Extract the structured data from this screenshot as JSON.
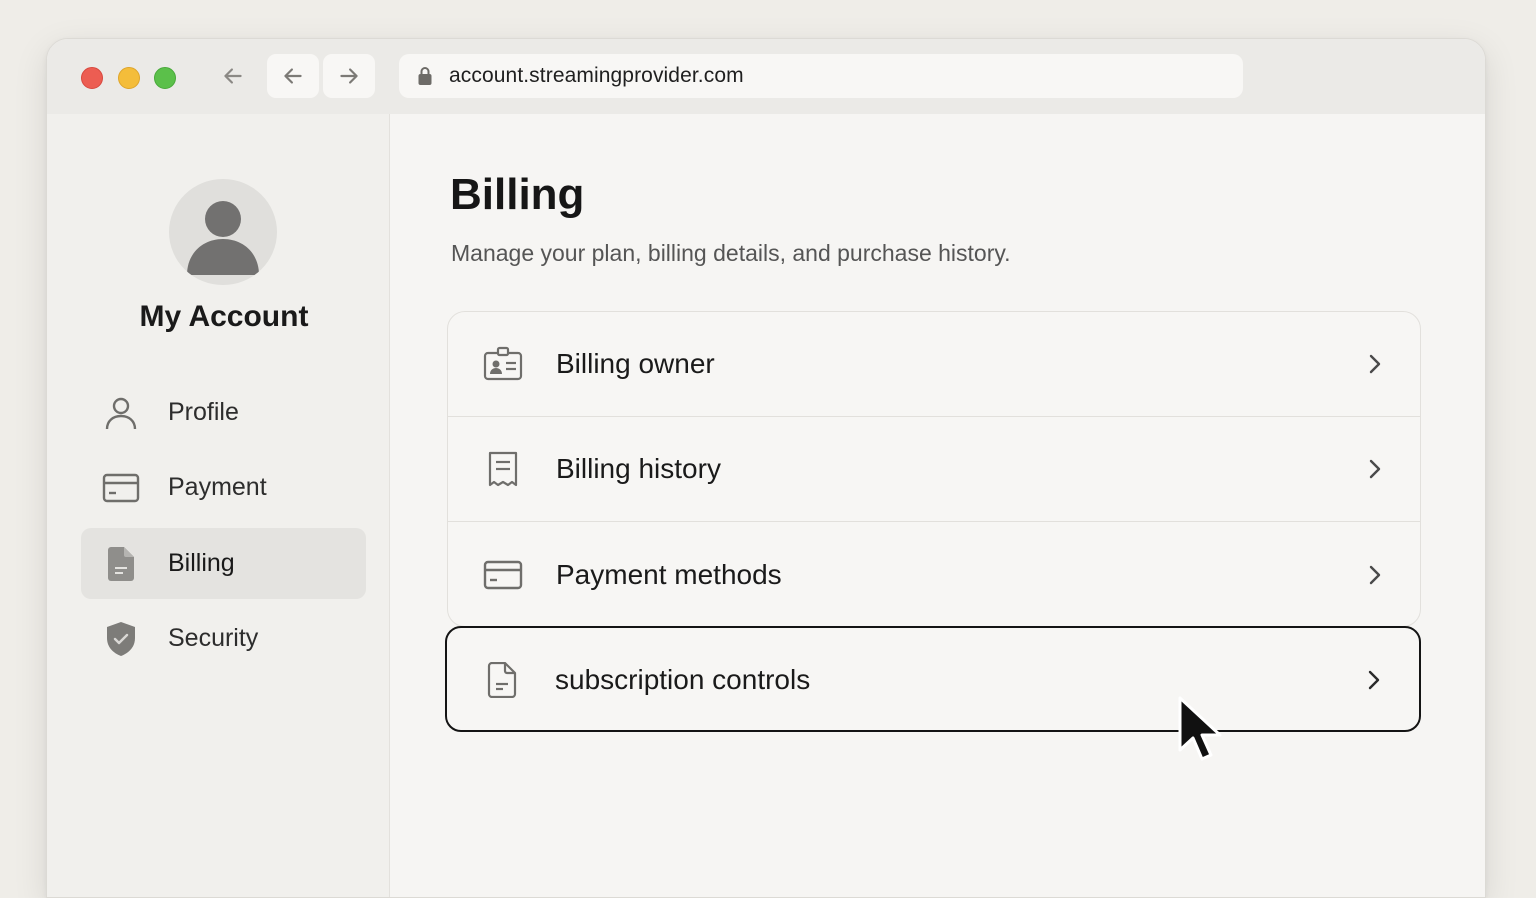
{
  "browser": {
    "url": "account.streamingprovider.com",
    "back_icon": "arrow-left-icon",
    "forward_icon": "arrow-right-icon",
    "lock_icon": "lock-icon"
  },
  "sidebar": {
    "title": "My Account",
    "avatar_icon": "user-silhouette-icon",
    "items": [
      {
        "label": "Profile",
        "icon": "person-icon",
        "active": false
      },
      {
        "label": "Payment",
        "icon": "credit-card-icon",
        "active": false
      },
      {
        "label": "Billing",
        "icon": "document-icon",
        "active": true
      },
      {
        "label": "Security",
        "icon": "shield-icon",
        "active": false
      }
    ]
  },
  "main": {
    "title": "Billing",
    "subtitle": "Manage your plan, billing details, and purchase history.",
    "rows": [
      {
        "label": "Billing owner",
        "icon": "id-card-icon"
      },
      {
        "label": "Billing history",
        "icon": "receipt-icon"
      },
      {
        "label": "Payment methods",
        "icon": "credit-card-icon"
      },
      {
        "label": "subscription controls",
        "icon": "document-icon",
        "focused": true
      }
    ]
  },
  "colors": {
    "window_bg": "#f6f5f3",
    "sidebar_bg": "#f1f0ed",
    "active_item_bg": "#e4e3e0",
    "focus_border": "#141414",
    "traffic_red": "#ec5d52",
    "traffic_yellow": "#f4bd3a",
    "traffic_green": "#5bc04a"
  }
}
